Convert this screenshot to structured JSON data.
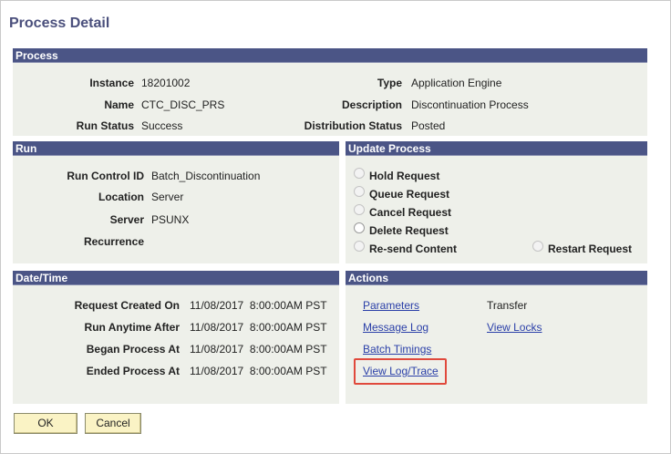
{
  "page": {
    "title": "Process Detail"
  },
  "process": {
    "header": "Process",
    "instance_label": "Instance",
    "instance_value": "18201002",
    "name_label": "Name",
    "name_value": "CTC_DISC_PRS",
    "run_status_label": "Run Status",
    "run_status_value": "Success",
    "type_label": "Type",
    "type_value": "Application Engine",
    "description_label": "Description",
    "description_value": "Discontinuation Process",
    "dist_status_label": "Distribution Status",
    "dist_status_value": "Posted"
  },
  "run": {
    "header": "Run",
    "run_control_label": "Run Control ID",
    "run_control_value": "Batch_Discontinuation",
    "location_label": "Location",
    "location_value": "Server",
    "server_label": "Server",
    "server_value": "PSUNX",
    "recurrence_label": "Recurrence",
    "recurrence_value": ""
  },
  "update_process": {
    "header": "Update Process",
    "hold": "Hold Request",
    "queue": "Queue Request",
    "cancel": "Cancel Request",
    "delete": "Delete Request",
    "resend": "Re-send Content",
    "restart": "Restart Request"
  },
  "datetime": {
    "header": "Date/Time",
    "created_label": "Request Created On",
    "created_value": "11/08/2017  8:00:00AM PST",
    "anytime_label": "Run Anytime After",
    "anytime_value": "11/08/2017  8:00:00AM PST",
    "began_label": "Began Process At",
    "began_value": "11/08/2017  8:00:00AM PST",
    "ended_label": "Ended Process At",
    "ended_value": "11/08/2017  8:00:00AM PST"
  },
  "actions": {
    "header": "Actions",
    "parameters": "Parameters",
    "transfer": "Transfer",
    "message_log": "Message Log",
    "view_locks": "View Locks",
    "batch_timings": "Batch Timings",
    "view_log_trace": "View Log/Trace"
  },
  "buttons": {
    "ok": "OK",
    "cancel": "Cancel"
  },
  "colors": {
    "header_bg": "#4b5586",
    "section_bg": "#eef0ea",
    "link": "#2a3fa8",
    "highlight": "#e0493c",
    "button_bg": "#faf3c5"
  }
}
